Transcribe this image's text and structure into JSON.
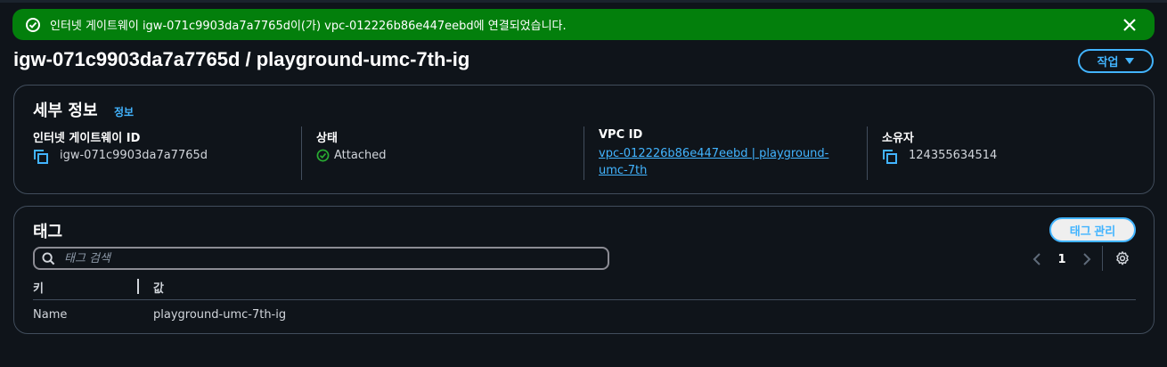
{
  "flash": {
    "message": "인터넷 게이트웨이 igw-071c9903da7a7765d이(가) vpc-012226b86e447eebd에 연결되었습니다.",
    "status_icon": "success-check-icon",
    "close_icon": "close-icon",
    "color": "#037f0c"
  },
  "page": {
    "title": "igw-071c9903da7a7765d / playground-umc-7th-ig",
    "actions_label": "작업"
  },
  "details": {
    "title": "세부 정보",
    "info_link": "정보",
    "fields": [
      {
        "label": "인터넷 게이트웨이 ID",
        "value": "igw-071c9903da7a7765d"
      },
      {
        "label": "상태",
        "value": "Attached"
      },
      {
        "label": "VPC ID",
        "value": "vpc-012226b86e447eebd | playground-umc-7th"
      },
      {
        "label": "소유자",
        "value": "124355634514"
      }
    ]
  },
  "tags": {
    "title": "태그",
    "manage_label": "태그 관리",
    "search_placeholder": "태그 검색",
    "page_number": "1",
    "columns": [
      "키",
      "값"
    ],
    "rows": [
      {
        "key": "Name",
        "value": "playground-umc-7th-ig"
      }
    ]
  },
  "colors": {
    "accent": "#42b4ff",
    "success": "#29ad32",
    "background": "#0f141a",
    "border": "#414d5c"
  }
}
